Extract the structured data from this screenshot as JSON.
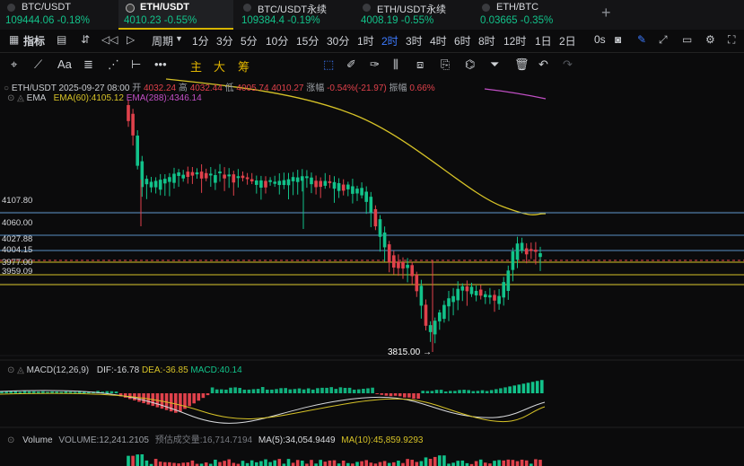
{
  "tabs": [
    {
      "name": "BTC/USDT",
      "quote": "109444.06 -0.18%"
    },
    {
      "name": "ETH/USDT",
      "quote": "4010.23 -0.55%"
    },
    {
      "name": "BTC/USDT永续",
      "quote": "109384.4 -0.19%"
    },
    {
      "name": "ETH/USDT永续",
      "quote": "4008.19 -0.55%"
    },
    {
      "name": "ETH/BTC",
      "quote": "0.03665 -0.35%"
    }
  ],
  "toolbar": {
    "indicator": "指标",
    "period": "周期",
    "intervals": [
      "1分",
      "3分",
      "5分",
      "10分",
      "15分",
      "30分",
      "1时",
      "2时",
      "3时",
      "4时",
      "6时",
      "8时",
      "12时",
      "1日",
      "2日"
    ],
    "selected_interval": "2时",
    "replay": "0s"
  },
  "drawbar": {
    "main": "主",
    "big": "大",
    "chip": "筹"
  },
  "colors": {
    "up": "#12c28a",
    "down": "#e0414b",
    "accent": "#3d7bff",
    "ema60": "#d6c227",
    "ema288": "#c04fc4",
    "brand": "#e0b400"
  },
  "candle_info": {
    "symbol": "ETH/USDT",
    "time": "2025-09-27 08:00",
    "open_l": "开",
    "open": "4032.24",
    "high_l": "高",
    "high": "4032.44",
    "low_l": "低",
    "low": "4005.74",
    "close": "4010.27",
    "change_l": "涨幅",
    "change": "-0.54%(-21.97)",
    "amp_l": "振幅",
    "amp": "0.66%"
  },
  "ema": {
    "label": "EMA",
    "ema60": "EMA(60):4105.12",
    "ema288": "EMA(288):4346.14"
  },
  "price_labels": [
    "4107.80",
    "4060.00",
    "4027.88",
    "4004.15",
    "3977.00",
    "3959.09"
  ],
  "low_marker": "3815.00",
  "macd": {
    "label": "MACD(12,26,9)",
    "dif": "DIF:-16.78",
    "dea": "DEA:-36.85",
    "macd": "MACD:40.14"
  },
  "volume": {
    "label": "Volume",
    "vol": "VOLUME:12,241.2105",
    "est": "预估成交量:16,714.7194",
    "ma5": "MA(5):34,054.9449",
    "ma10": "MA(10):45,859.9293"
  }
}
